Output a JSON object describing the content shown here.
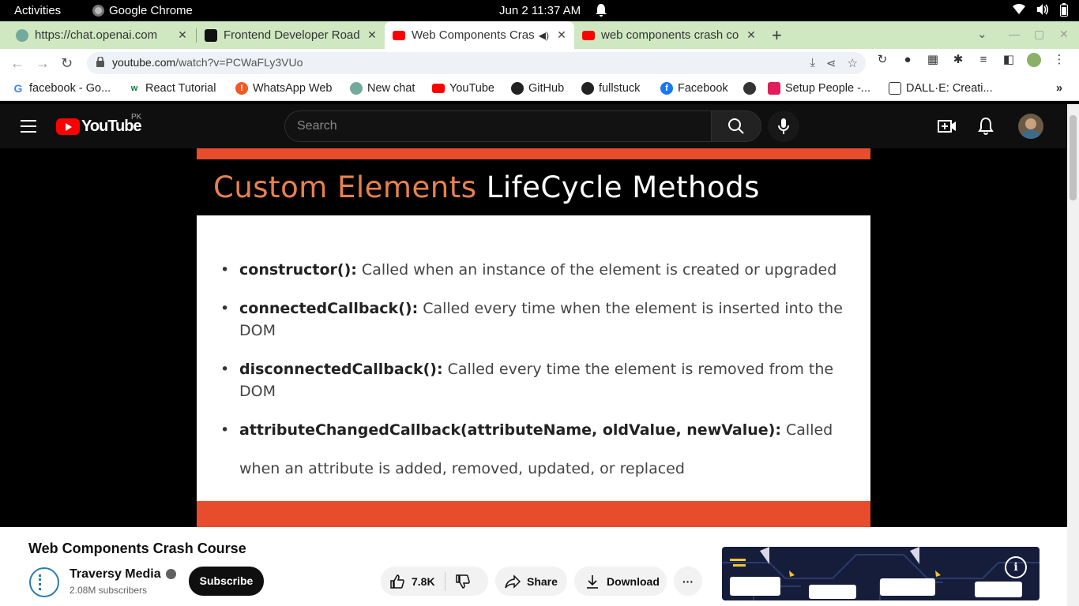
{
  "system": {
    "activities": "Activities",
    "app_name": "Google Chrome",
    "clock": "Jun 2  11:37 AM"
  },
  "tabs": [
    {
      "title": "https://chat.openai.com"
    },
    {
      "title": "Frontend Developer Road"
    },
    {
      "title": "Web Components Cras"
    },
    {
      "title": "web components crash co"
    }
  ],
  "omnibox": {
    "host": "youtube.com",
    "path": "/watch?v=PCWaFLy3VUo"
  },
  "bookmarks": [
    {
      "label": "facebook - Go..."
    },
    {
      "label": "React Tutorial"
    },
    {
      "label": "WhatsApp Web"
    },
    {
      "label": "New chat"
    },
    {
      "label": "YouTube"
    },
    {
      "label": "GitHub"
    },
    {
      "label": "fullstuck"
    },
    {
      "label": "Facebook"
    },
    {
      "label": "Setup People -..."
    },
    {
      "label": "DALL·E: Creati..."
    }
  ],
  "youtube": {
    "logo_text": "YouTube",
    "region": "PK",
    "search_placeholder": "Search"
  },
  "slide": {
    "title_orange": "Custom Elements",
    "title_white": "LifeCycle Methods",
    "items": [
      {
        "name": "constructor():",
        "desc": "Called when an instance of the element is created or upgraded"
      },
      {
        "name": "connectedCallback():",
        "desc": "Called every time when the element is inserted into the DOM"
      },
      {
        "name": "disconnectedCallback():",
        "desc": "Called every time the element is removed from the DOM"
      },
      {
        "name": "attributeChangedCallback(attributeName, oldValue, newValue):",
        "desc": "Called when an attribute is added, removed, updated, or replaced"
      }
    ]
  },
  "video": {
    "title": "Web Components Crash Course",
    "channel": "Traversy Media",
    "subscribers": "2.08M subscribers",
    "subscribe_label": "Subscribe",
    "likes": "7.8K",
    "share_label": "Share",
    "download_label": "Download",
    "more_label": "···"
  }
}
